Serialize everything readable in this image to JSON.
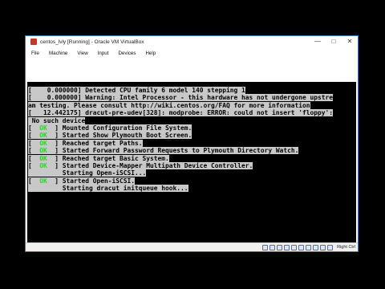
{
  "window": {
    "title": "centos_lvly [Running] - Oracle VM VirtualBox",
    "controls": {
      "minimize": "—",
      "maximize": "□",
      "close": "✕"
    }
  },
  "menu": [
    "File",
    "Machine",
    "View",
    "Input",
    "Devices",
    "Help"
  ],
  "console": {
    "lines": [
      {
        "pre": "[    0.000000] Detected CPU family 6 model 140 stepping 1",
        "ok": "",
        "post": "",
        "style": "highlight"
      },
      {
        "pre": "[    0.000000] Warning: Intel Processor - this hardware has not undergone upstre",
        "ok": "",
        "post": "",
        "style": "highlight"
      },
      {
        "pre": "am testing. Please consult http://wiki.centos.org/FAQ for more information",
        "ok": "",
        "post": "",
        "style": "highlight"
      },
      {
        "pre": "[   12.442175] dracut-pre-udev[328]: modprobe: ERROR: could not insert 'floppy':",
        "ok": "",
        "post": "",
        "style": "highlight"
      },
      {
        "pre": " No such device",
        "ok": "",
        "post": "",
        "style": "highlight"
      },
      {
        "pre": "[  ",
        "ok": "OK",
        "post": "  ] Mounted Configuration File System.",
        "style": "highlight"
      },
      {
        "pre": "[  ",
        "ok": "OK",
        "post": "  ] Started Show Plymouth Boot Screen.",
        "style": "highlight"
      },
      {
        "pre": "[  ",
        "ok": "OK",
        "post": "  ] Reached target Paths.",
        "style": "highlight"
      },
      {
        "pre": "[  ",
        "ok": "OK",
        "post": "  ] Started Forward Password Requests to Plymouth Directory Watch.",
        "style": "highlight"
      },
      {
        "pre": "[  ",
        "ok": "OK",
        "post": "  ] Reached target Basic System.",
        "style": "highlight"
      },
      {
        "pre": "[  ",
        "ok": "OK",
        "post": "  ] Started Device-Mapper Multipath Device Controller.",
        "style": "highlight"
      },
      {
        "pre": "         Starting Open-iSCSI...",
        "ok": "",
        "post": "",
        "style": "highlight"
      },
      {
        "pre": "[  ",
        "ok": "OK",
        "post": "  ] Started Open-iSCSI.",
        "style": "highlight"
      },
      {
        "pre": "         Starting dracut initqueue hook...",
        "ok": "",
        "post": "",
        "style": "highlight"
      }
    ]
  },
  "status": {
    "host_key": "Right Ctrl",
    "icons": [
      "hard-disk-icon",
      "optical-drive-icon",
      "usb-icon",
      "shared-folder-icon",
      "display-icon",
      "network-icon",
      "recording-icon",
      "cpu-icon",
      "mouse-integration-icon",
      "keyboard-icon"
    ]
  },
  "colors": {
    "ok": "#2fd12f",
    "console_bg": "#000000",
    "console_highlight": "#c8c8c8",
    "frame_border": "#4a6fb3"
  }
}
